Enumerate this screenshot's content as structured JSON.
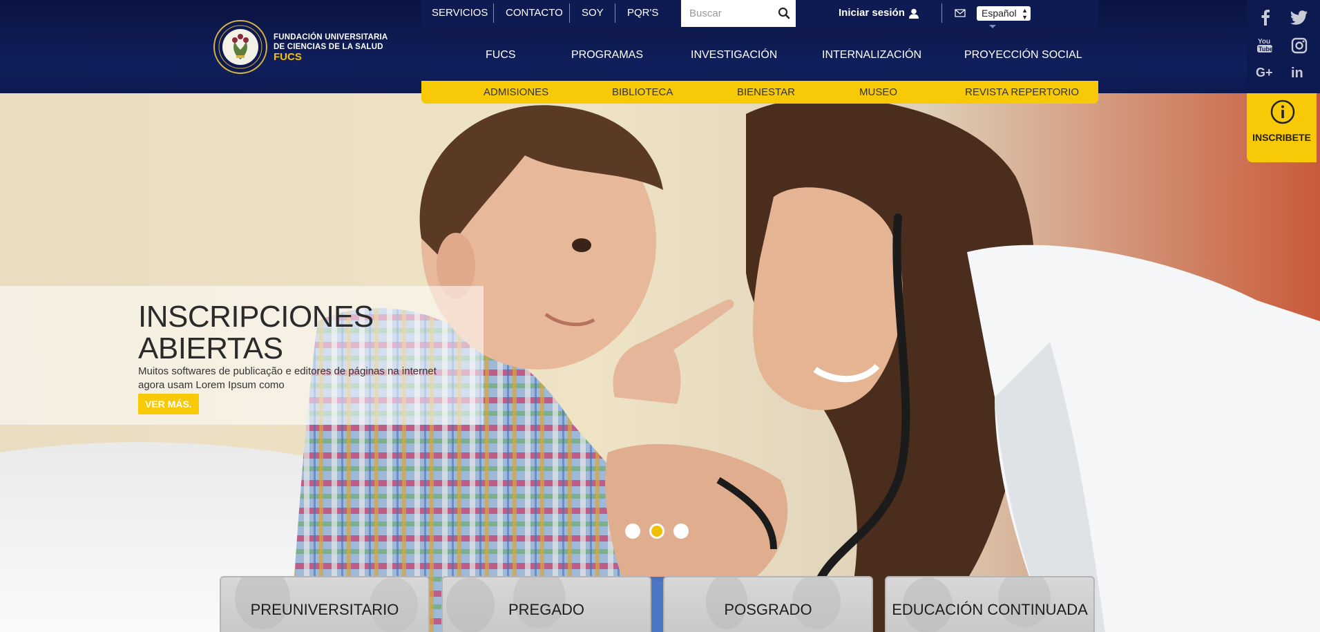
{
  "logo": {
    "line1": "FUNDACIÓN UNIVERSITARIA",
    "line2": "DE CIENCIAS DE LA SALUD",
    "line3": "FUCS"
  },
  "topbar": {
    "links": [
      "SERVICIOS",
      "CONTACTO",
      "SOY",
      "PQR'S"
    ],
    "search_placeholder": "Buscar",
    "login_label": "Iniciar sesión",
    "language": "Español"
  },
  "mainnav": [
    "FUCS",
    "PROGRAMAS",
    "INVESTIGACIÓN",
    "INTERNALIZACIÓN",
    "PROYECCIÓN SOCIAL"
  ],
  "subnav": [
    "ADMISIONES",
    "BIBLIOTECA",
    "BIENESTAR",
    "MUSEO",
    "REVISTA REPERTORIO"
  ],
  "social": [
    "facebook-icon",
    "twitter-icon",
    "youtube-icon",
    "instagram-icon",
    "google-plus-icon",
    "linkedin-icon"
  ],
  "inscribete_label": "INSCRIBETE",
  "hero": {
    "title_line1": "INSCRIPCIONES",
    "title_line2": "ABIERTAS",
    "text": "Muitos softwares de publicação e editores de páginas na internet agora usam Lorem Ipsum como",
    "button": "VER MÁS."
  },
  "cards": [
    "PREUNIVERSITARIO",
    "PREGADO",
    "POSGRADO",
    "EDUCACIÓN CONTINUADA"
  ],
  "colors": {
    "navy": "#0e1a52",
    "yellow": "#f8c906"
  }
}
